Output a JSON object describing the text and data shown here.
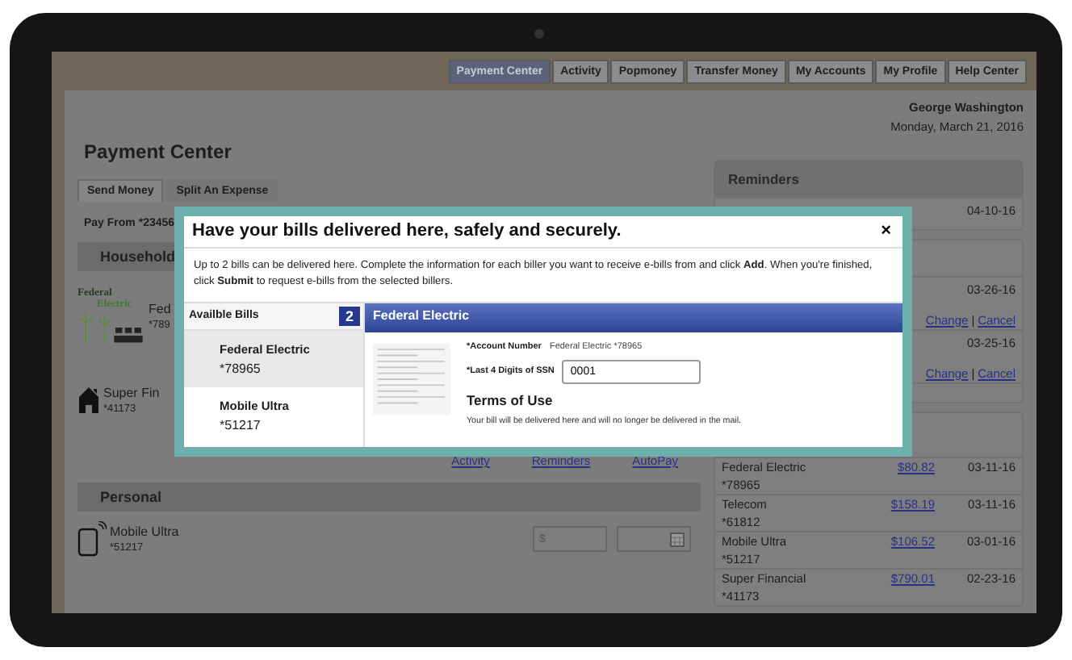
{
  "nav": {
    "tabs": [
      {
        "label": "Payment Center",
        "selected": true
      },
      {
        "label": "Activity",
        "selected": false
      },
      {
        "label": "Popmoney",
        "selected": false
      },
      {
        "label": "Transfer Money",
        "selected": false
      },
      {
        "label": "My Accounts",
        "selected": false
      },
      {
        "label": "My Profile",
        "selected": false
      },
      {
        "label": "Help Center",
        "selected": false
      }
    ]
  },
  "user": {
    "name": "George Washington",
    "date": "Monday, March 21, 2016"
  },
  "title": "Payment Center",
  "left": {
    "tabs": [
      {
        "label": "Send Money",
        "selected": true
      },
      {
        "label": "Split An Expense",
        "selected": false
      }
    ],
    "pay_from": "Pay From *23456",
    "household": {
      "header": "Household",
      "payees": [
        {
          "kind": "logo",
          "logo_top": "Federal",
          "logo_bottom": "Electric",
          "name": "Fed",
          "account": "*789"
        },
        {
          "kind": "house",
          "name": "Super Fin",
          "account": "*41173"
        }
      ]
    },
    "links": [
      "Activity",
      "Reminders",
      "AutoPay"
    ],
    "personal": {
      "header": "Personal",
      "payees": [
        {
          "kind": "tablet",
          "name": "Mobile Ultra",
          "account": "*51217",
          "amount_placeholder": "$"
        }
      ]
    }
  },
  "right": {
    "reminders": {
      "header": "Reminders",
      "date": "04-10-16"
    },
    "scheduled": [
      {
        "date": "03-26-16",
        "actions": [
          "Change",
          "Cancel"
        ],
        "separator": "|"
      },
      {
        "date": "03-25-16",
        "actions": [
          "Change",
          "Cancel"
        ],
        "separator": "|"
      }
    ],
    "history": [
      {
        "name": "Federal Electric",
        "account": "*78965",
        "amount": "$80.82",
        "date": "03-11-16"
      },
      {
        "name": "Telecom",
        "account": "*61812",
        "amount": "$158.19",
        "date": "03-11-16"
      },
      {
        "name": "Mobile Ultra",
        "account": "*51217",
        "amount": "$106.52",
        "date": "03-01-16"
      },
      {
        "name": "Super Financial",
        "account": "*41173",
        "amount": "$790.01",
        "date": "02-23-16"
      }
    ]
  },
  "modal": {
    "title": "Have your bills delivered here, safely and securely.",
    "close": "×",
    "intro": "Up to 2 bills can be delivered here. Complete the information for each biller you want to receive e-bills from and click **Add**. When you're finished, click **Submit** to request e-bills from the selected billers.",
    "list_header": "Availble Bills",
    "count": "2",
    "bills": [
      {
        "name": "Federal Electric",
        "account": "*78965",
        "selected": true
      },
      {
        "name": "Mobile Ultra",
        "account": "*51217",
        "selected": false
      }
    ],
    "detail": {
      "header": "Federal Electric",
      "account_label": "*Account Number",
      "account_value": "Federal Electric *78965",
      "ssn_label": "*Last 4 Digits of SSN",
      "ssn_value": "0001",
      "terms_title": "Terms of Use",
      "terms_text": "Your bill will be delivered here and will no longer be delivered in the mail."
    }
  }
}
